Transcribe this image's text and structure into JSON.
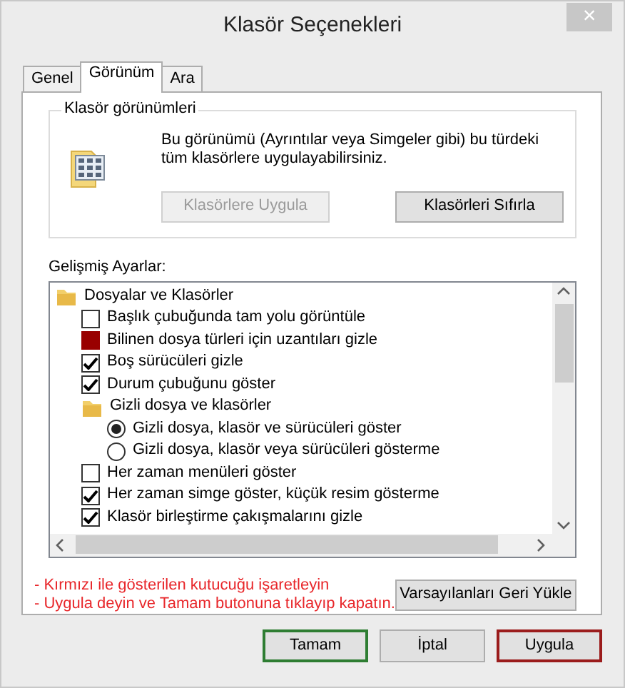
{
  "window": {
    "title": "Klasör Seçenekleri",
    "close": "×"
  },
  "tabs": [
    {
      "label": "Genel",
      "selected": false
    },
    {
      "label": "Görünüm",
      "selected": true
    },
    {
      "label": "Ara",
      "selected": false
    }
  ],
  "folder_views": {
    "legend": "Klasör görünümleri",
    "description": "Bu görünümü (Ayrıntılar veya Simgeler gibi) bu türdeki tüm klasörlere uygulayabilirsiniz.",
    "buttons": [
      {
        "label": "Klasörlere Uygula",
        "disabled": true
      },
      {
        "label": "Klasörleri Sıfırla",
        "disabled": false
      }
    ]
  },
  "advanced": {
    "label": "Gelişmiş Ayarlar:",
    "tree": [
      {
        "kind": "folder",
        "label": "Dosyalar ve Klasörler",
        "children": [
          {
            "kind": "checkbox",
            "label": "Başlık çubuğunda tam yolu görüntüle",
            "checked": false,
            "highlighted": false
          },
          {
            "kind": "checkbox",
            "label": "Bilinen dosya türleri için uzantıları gizle",
            "checked": false,
            "highlighted": true
          },
          {
            "kind": "checkbox",
            "label": "Boş sürücüleri gizle",
            "checked": true,
            "highlighted": false
          },
          {
            "kind": "checkbox",
            "label": "Durum çubuğunu göster",
            "checked": true,
            "highlighted": false
          },
          {
            "kind": "folder",
            "label": "Gizli dosya ve klasörler",
            "children": [
              {
                "kind": "radio",
                "label": "Gizli dosya, klasör ve sürücüleri göster",
                "selected": true
              },
              {
                "kind": "radio",
                "label": "Gizli dosya, klasör veya sürücüleri gösterme",
                "selected": false
              }
            ]
          },
          {
            "kind": "checkbox",
            "label": "Her zaman menüleri göster",
            "checked": false,
            "highlighted": false
          },
          {
            "kind": "checkbox",
            "label": "Her zaman simge göster, küçük resim gösterme",
            "checked": true,
            "highlighted": false
          },
          {
            "kind": "checkbox",
            "label": "Klasör birleştirme çakışmalarını gizle",
            "checked": true,
            "highlighted": false
          }
        ]
      }
    ]
  },
  "notes": [
    "- Kırmızı ile gösterilen kutucuğu işaretleyin",
    "- Uygula deyin ve Tamam butonuna tıklayıp kapatın."
  ],
  "restore_button": "Varsayılanları Geri Yükle",
  "buttons": [
    {
      "label": "Tamam",
      "color": "#2e7d32"
    },
    {
      "label": "İptal"
    },
    {
      "label": "Uygula",
      "color": "#9b1c1c"
    }
  ]
}
